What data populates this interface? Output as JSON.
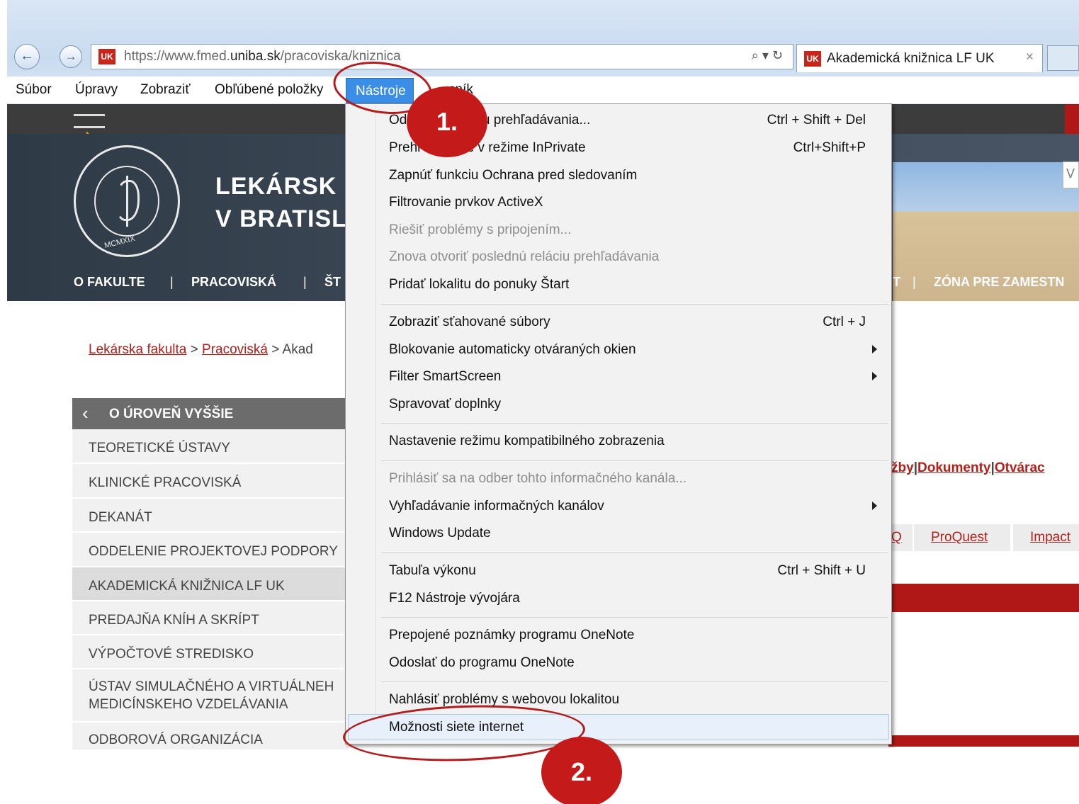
{
  "browser": {
    "address_url_prefix": "https://www.fmed.",
    "address_url_domain": "uniba.sk",
    "address_url_path": "/pracoviska/kniznica",
    "address_tools": "⌕ ▾ ↻",
    "favicon": "UK",
    "tab_title": "Akademická knižnica LF UK",
    "tab_close": "×"
  },
  "menubar": {
    "items": [
      "Súbor",
      "Úpravy",
      "Zobraziť",
      "Obľúbené položky",
      "Nástroje",
      "cník"
    ]
  },
  "site": {
    "title_line1": "LEKÁRSK",
    "title_line2": "V BRATISL",
    "logo_text": "MCMXIX",
    "nav": [
      "O FAKULTE",
      "|",
      "PRACOVISKÁ",
      "|",
      "ŠT",
      "T",
      "|",
      "ZÓNA PRE ZAMESTN"
    ],
    "search_stub": "V"
  },
  "breadcrumb": {
    "link1": "Lekárska fakulta",
    "sep1": " > ",
    "link2": "Pracoviská",
    "sep2": " > Akad"
  },
  "sidebar": {
    "back_icon": "‹",
    "header": "O ÚROVEŇ VYŠŠIE",
    "items": [
      "TEORETICKÉ ÚSTAVY",
      "KLINICKÉ PRACOVISKÁ",
      "DEKANÁT",
      "ODDELENIE PROJEKTOVEJ PODPORY",
      "AKADEMICKÁ KNIŽNICA LF UK",
      "PREDAJŇA KNÍH A SKRÍPT",
      "VÝPOČTOVÉ STREDISKO",
      "ÚSTAV SIMULAČNÉHO A VIRTUÁLNEH",
      "MEDICÍNSKEHO VZDELÁVANIA",
      "ODBOROVÁ ORGANIZÁCIA"
    ]
  },
  "content": {
    "links": [
      "žby",
      "|",
      "Dokumenty",
      "|",
      "Otvárac"
    ],
    "db_tabs": [
      "Q",
      "ProQuest",
      "Impact"
    ]
  },
  "dropdown": {
    "items": [
      {
        "label": "Od",
        "label_tail": "riu prehľadávania...",
        "shortcut": "Ctrl + Shift + Del"
      },
      {
        "label": "Prehľ",
        "label_tail": "e v režime InPrivate",
        "shortcut": "Ctrl+Shift+P"
      },
      {
        "label": "Zapnúť funkciu Ochrana pred sledovaním"
      },
      {
        "label": "Filtrovanie prvkov ActiveX"
      },
      {
        "label": "Riešiť problémy s pripojením...",
        "disabled": true
      },
      {
        "label": "Znova otvoriť poslednú reláciu prehľadávania",
        "disabled": true
      },
      {
        "label": "Pridať lokalitu do ponuky Štart"
      },
      {
        "label": "Zobraziť sťahované súbory",
        "shortcut": "Ctrl + J"
      },
      {
        "label": "Blokovanie automaticky otváraných okien",
        "submenu": true
      },
      {
        "label": "Filter SmartScreen",
        "submenu": true
      },
      {
        "label": "Spravovať doplnky"
      },
      {
        "label": "Nastavenie režimu kompatibilného zobrazenia"
      },
      {
        "label": "Prihlásiť sa na odber tohto informačného kanála...",
        "disabled": true
      },
      {
        "label": "Vyhľadávanie informačných kanálov",
        "submenu": true
      },
      {
        "label": "Windows Update"
      },
      {
        "label": "Tabuľa výkonu",
        "shortcut": "Ctrl + Shift + U"
      },
      {
        "label": "F12 Nástroje vývojára"
      },
      {
        "label": "Prepojené poznámky programu OneNote"
      },
      {
        "label": "Odoslať do programu OneNote"
      },
      {
        "label": "Nahlásiť problémy s webovou lokalitou"
      },
      {
        "label": "Možnosti siete internet"
      }
    ]
  },
  "annotations": {
    "step1": "1.",
    "step2": "2.",
    "color": "#c41a1a"
  },
  "colors": {
    "brand_red": "#b01818",
    "menu_highlight": "#3a8ee6",
    "hero_bg": "#3b4754"
  }
}
